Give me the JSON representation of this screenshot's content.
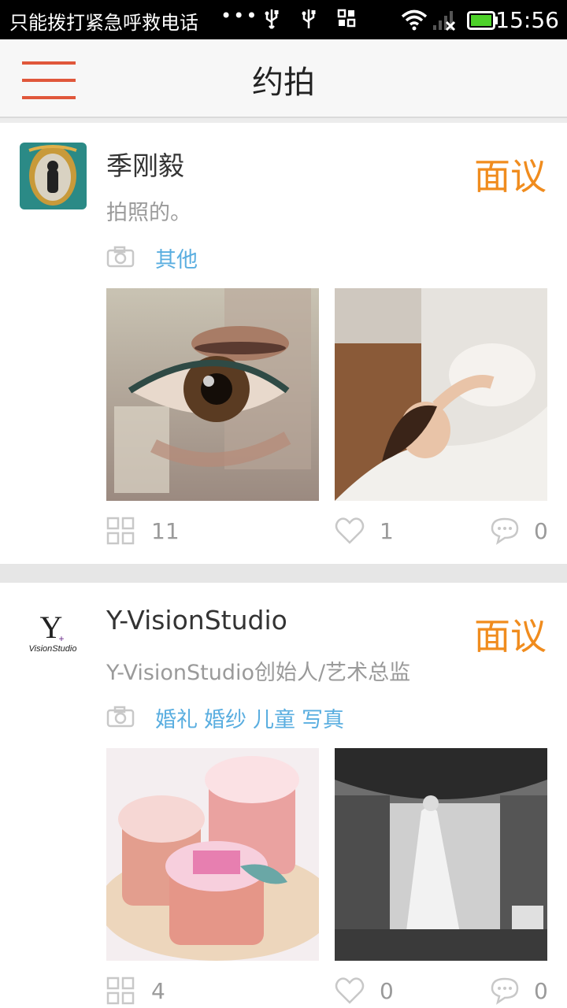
{
  "status_bar": {
    "left_text": "只能拨打紧急呼救电话",
    "time": "15:56"
  },
  "header": {
    "title": "约拍",
    "menu_icon": "hamburger-menu-icon"
  },
  "accent_colors": {
    "price": "#f08c1e",
    "tag": "#5aaee0",
    "menu": "#e0573b"
  },
  "posts": [
    {
      "name": "季刚毅",
      "price": "面议",
      "description": "拍照的。",
      "tags": [
        "其他"
      ],
      "photos_count": "11",
      "likes": "1",
      "comments": "0"
    },
    {
      "name": "Y-VisionStudio",
      "price": "面议",
      "description": "Y-VisionStudio创始人/艺术总监",
      "tags": [
        "婚礼",
        "婚纱",
        "儿童",
        "写真"
      ],
      "photos_count": "4",
      "likes": "0",
      "comments": "0",
      "avatar_logo_text": "Y VisionStudio"
    }
  ]
}
